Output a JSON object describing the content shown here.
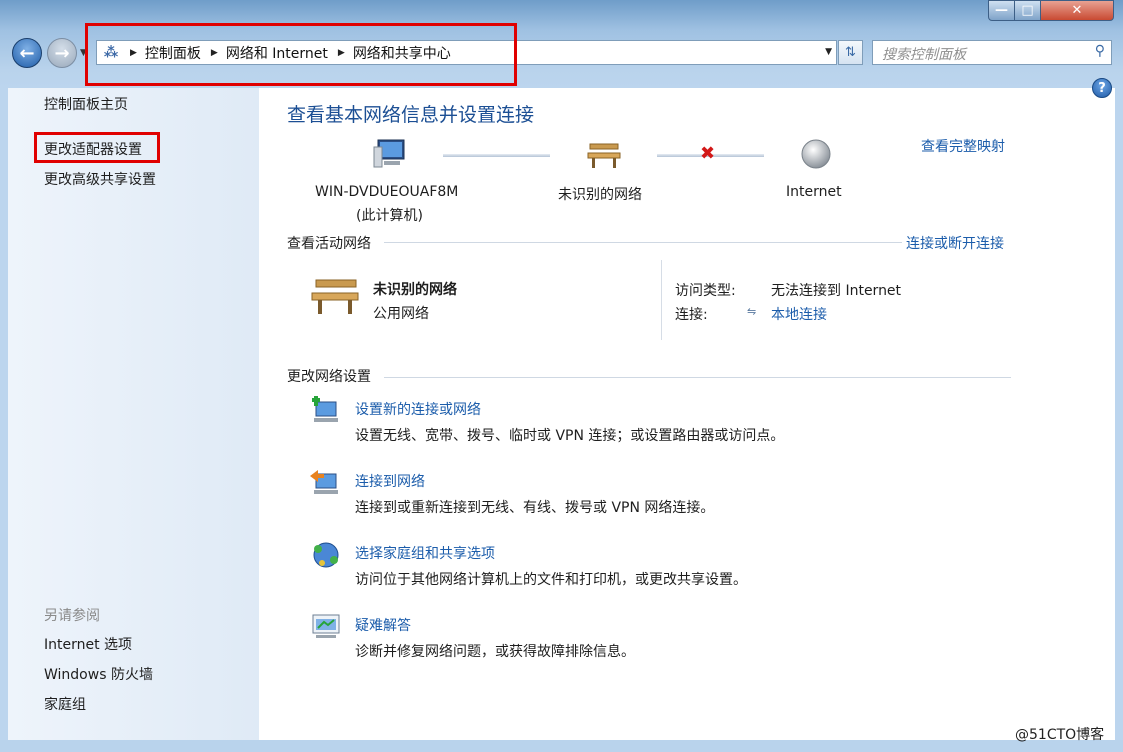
{
  "window": {
    "minimize": "—",
    "maximize": "□",
    "close": "✕"
  },
  "nav": {
    "back": "←",
    "forward": "→",
    "breadcrumb": [
      "控制面板",
      "网络和 Internet",
      "网络和共享中心"
    ],
    "search_placeholder": "搜索控制面板"
  },
  "sidebar": {
    "home": "控制面板主页",
    "adapter_settings": "更改适配器设置",
    "advanced_sharing": "更改高级共享设置",
    "see_also_title": "另请参阅",
    "see_also": [
      "Internet 选项",
      "Windows 防火墙",
      "家庭组"
    ]
  },
  "main": {
    "title": "查看基本网络信息并设置连接",
    "view_full_map": "查看完整映射",
    "map": {
      "computer_name": "WIN-DVDUEOUAF8M",
      "computer_sub": "(此计算机)",
      "network": "未识别的网络",
      "internet": "Internet"
    },
    "active_networks": {
      "title": "查看活动网络",
      "connect_link": "连接或断开连接",
      "network_name": "未识别的网络",
      "network_type": "公用网络",
      "access_type_label": "访问类型:",
      "access_type_value": "无法连接到 Internet",
      "connection_label": "连接:",
      "connection_value": "本地连接"
    },
    "change_settings": {
      "title": "更改网络设置",
      "tasks": [
        {
          "link": "设置新的连接或网络",
          "desc": "设置无线、宽带、拨号、临时或 VPN 连接；或设置路由器或访问点。"
        },
        {
          "link": "连接到网络",
          "desc": "连接到或重新连接到无线、有线、拨号或 VPN 网络连接。"
        },
        {
          "link": "选择家庭组和共享选项",
          "desc": "访问位于其他网络计算机上的文件和打印机，或更改共享设置。"
        },
        {
          "link": "疑难解答",
          "desc": "诊断并修复网络问题，或获得故障排除信息。"
        }
      ]
    }
  },
  "watermark": "@51CTO博客",
  "colors": {
    "highlight": "#e00000",
    "link": "#1c5dab"
  }
}
